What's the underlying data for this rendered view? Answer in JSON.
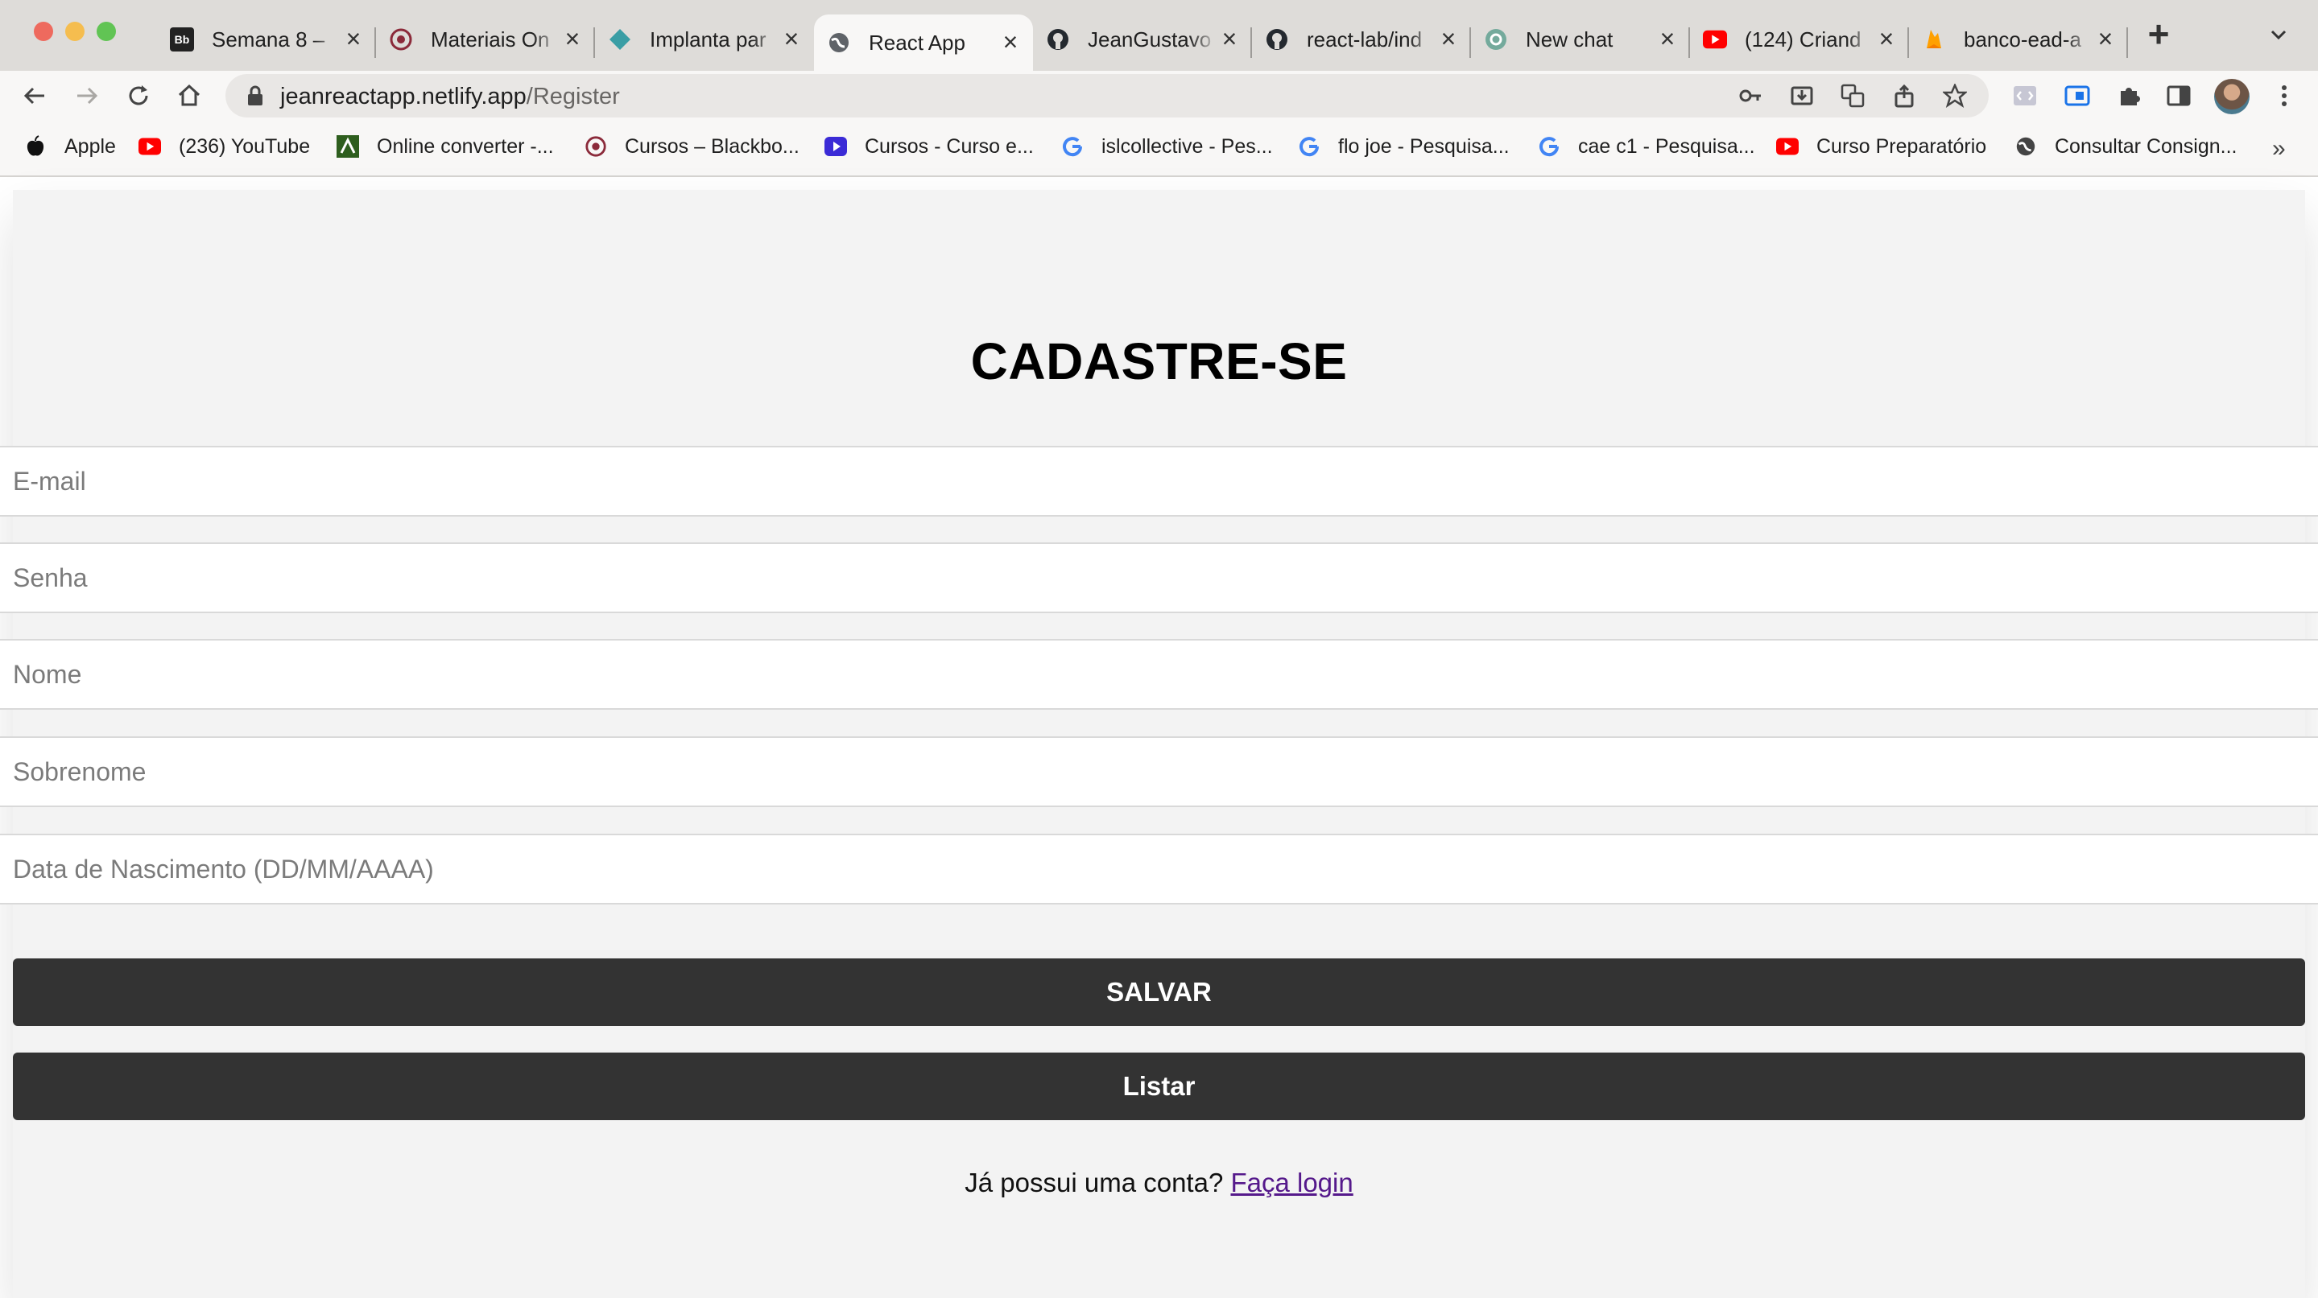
{
  "browser": {
    "tabs": [
      {
        "title": "Semana 8 –",
        "icon": "blackboard-icon"
      },
      {
        "title": "Materiais On",
        "icon": "institution-icon"
      },
      {
        "title": "Implanta par",
        "icon": "diamond-icon"
      },
      {
        "title": "React App",
        "icon": "globe-icon",
        "active": true
      },
      {
        "title": "JeanGustavo",
        "icon": "github-icon"
      },
      {
        "title": "react-lab/ind",
        "icon": "github-icon"
      },
      {
        "title": "New chat",
        "icon": "openai-icon"
      },
      {
        "title": "(124) Criand",
        "icon": "youtube-icon"
      },
      {
        "title": "banco-ead-a",
        "icon": "firebase-icon"
      }
    ],
    "url_host": "jeanreactapp.netlify.app",
    "url_path": "/Register",
    "bookmarks": [
      {
        "label": "Apple",
        "icon": "apple-icon"
      },
      {
        "label": "(236) YouTube",
        "icon": "youtube-icon"
      },
      {
        "label": "Online converter -...",
        "icon": "converter-icon"
      },
      {
        "label": "Cursos – Blackbo...",
        "icon": "institution-icon"
      },
      {
        "label": "Cursos - Curso e...",
        "icon": "course-icon"
      },
      {
        "label": "islcollective - Pes...",
        "icon": "google-icon"
      },
      {
        "label": "flo joe - Pesquisa...",
        "icon": "google-icon"
      },
      {
        "label": "cae c1 - Pesquisa...",
        "icon": "google-icon"
      },
      {
        "label": "Curso Preparatório",
        "icon": "youtube-icon"
      },
      {
        "label": "Consultar Consign...",
        "icon": "globe-icon"
      }
    ],
    "bookmarks_more": "»",
    "colors": {
      "active_tab": "#f8f7f6",
      "tabstrip": "#dedcd9",
      "omnibox": "#e9e7e5"
    }
  },
  "form": {
    "title": "CADASTRE-SE",
    "fields": {
      "email": "E-mail",
      "password": "Senha",
      "first_name": "Nome",
      "last_name": "Sobrenome",
      "birth_date": "Data de Nascimento (DD/MM/AAAA)"
    },
    "save_label": "SALVAR",
    "list_label": "Listar",
    "login_prompt": "Já possui uma conta?",
    "login_link": "Faça login",
    "colors": {
      "button": "#333333",
      "background": "#f3f3f3",
      "link": "#55198b"
    }
  }
}
